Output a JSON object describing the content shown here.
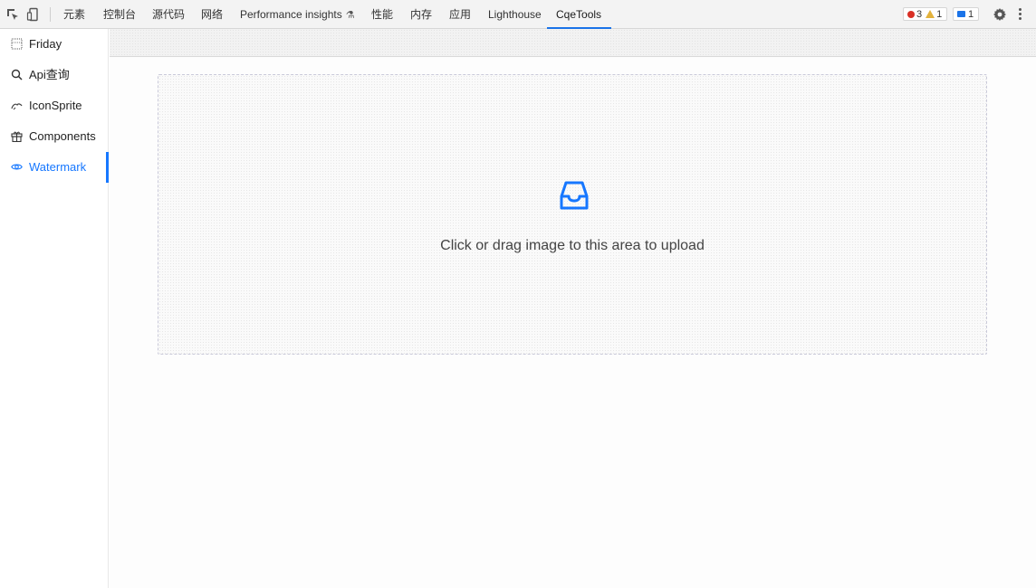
{
  "devtools": {
    "tabs": [
      {
        "label": "元素"
      },
      {
        "label": "控制台"
      },
      {
        "label": "源代码"
      },
      {
        "label": "网络"
      },
      {
        "label": "Performance insights"
      },
      {
        "label": "性能"
      },
      {
        "label": "内存"
      },
      {
        "label": "应用"
      },
      {
        "label": "Lighthouse"
      },
      {
        "label": "CqeTools"
      }
    ],
    "active_tab": "CqeTools",
    "errors_count": "3",
    "warnings_count": "1",
    "messages_count": "1",
    "icons": {
      "inspect": "inspect-element-icon",
      "device": "device-toolbar-icon",
      "flask": "experiment-flask-icon",
      "settings": "gear-icon",
      "more": "more-vertical-icon"
    },
    "colors": {
      "accent": "#1a73e8",
      "error": "#d93025",
      "warning": "#e3b23c"
    }
  },
  "sidebar": {
    "items": [
      {
        "label": "Friday",
        "icon": "grid-dotted-icon"
      },
      {
        "label": "Api查询",
        "icon": "search-icon"
      },
      {
        "label": "IconSprite",
        "icon": "cloud-sketch-icon"
      },
      {
        "label": "Components",
        "icon": "gift-icon"
      },
      {
        "label": "Watermark",
        "icon": "eye-icon"
      }
    ],
    "active_item": "Watermark",
    "colors": {
      "active": "#1677ff"
    }
  },
  "upload": {
    "icon": "inbox-icon",
    "text": "Click or drag image to this area to upload",
    "colors": {
      "icon": "#1677ff"
    }
  }
}
